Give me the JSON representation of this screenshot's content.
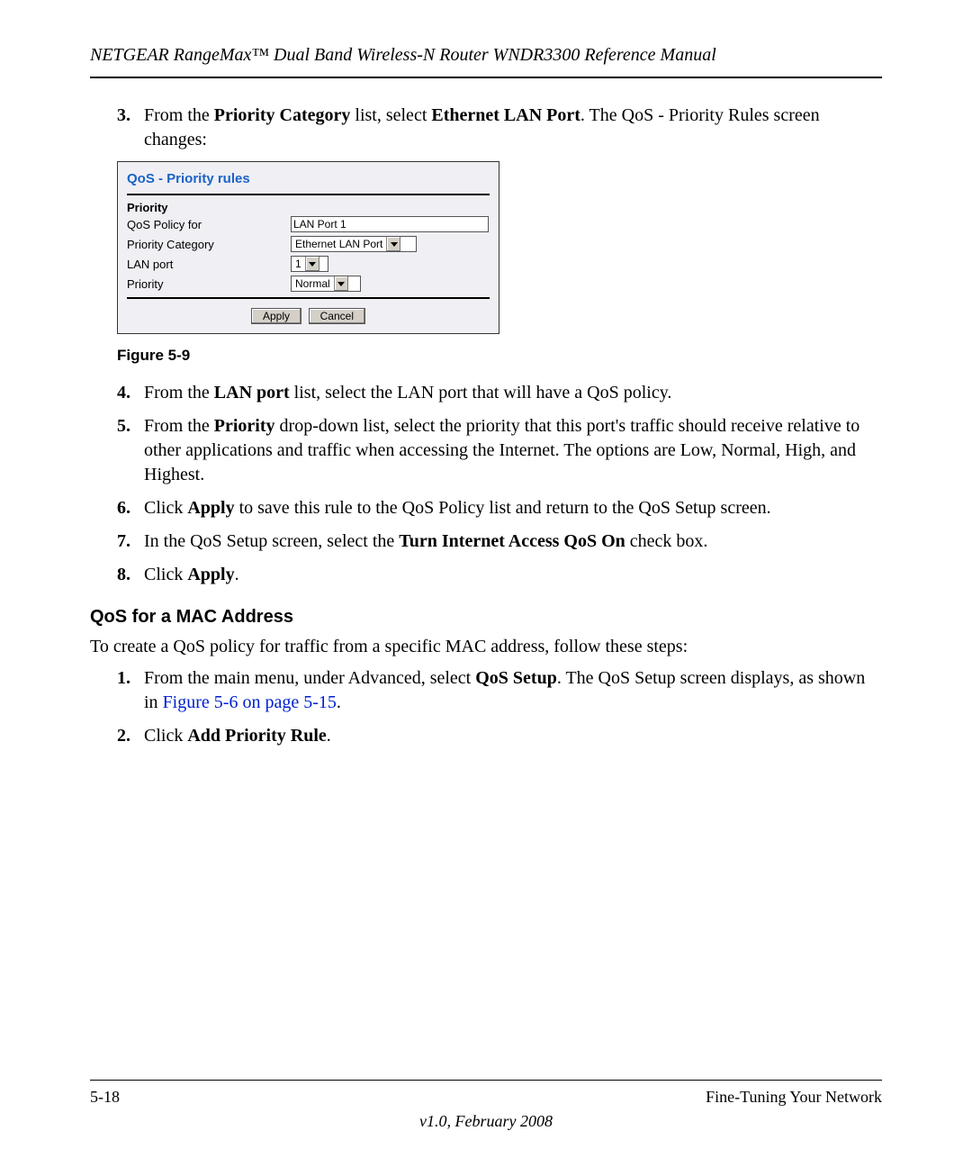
{
  "header": {
    "title": "NETGEAR RangeMax™ Dual Band Wireless-N Router WNDR3300 Reference Manual"
  },
  "steps_upper": [
    {
      "num": "3.",
      "html": "From the <b>Priority Category</b> list, select <b>Ethernet LAN Port</b>. The QoS - Priority Rules screen changes:"
    }
  ],
  "qos": {
    "panel_title": "QoS - Priority rules",
    "section_label": "Priority",
    "rows": {
      "policy_label": "QoS Policy for",
      "policy_value": "LAN Port 1",
      "category_label": "Priority Category",
      "category_value": "Ethernet LAN Port",
      "lanport_label": "LAN port",
      "lanport_value": "1",
      "priority_label": "Priority",
      "priority_value": "Normal"
    },
    "buttons": {
      "apply": "Apply",
      "cancel": "Cancel"
    }
  },
  "figure_caption": "Figure 5-9",
  "steps_mid": [
    {
      "num": "4.",
      "html": "From the <b>LAN port</b> list, select the LAN port that will have a QoS policy."
    },
    {
      "num": "5.",
      "html": "From the <b>Priority</b> drop-down list, select the priority that this port's traffic should receive relative to other applications and traffic when accessing the Internet. The options are Low, Normal, High, and Highest."
    },
    {
      "num": "6.",
      "html": "Click <b>Apply</b> to save this rule to the QoS Policy list and return to the QoS Setup screen."
    },
    {
      "num": "7.",
      "html": "In the QoS Setup screen, select the <b>Turn Internet Access QoS On</b> check box."
    },
    {
      "num": "8.",
      "html": "Click <b>Apply</b>."
    }
  ],
  "subheading": "QoS for a MAC Address",
  "subhead_intro": "To create a QoS policy for traffic from a specific MAC address, follow these steps:",
  "steps_lower": [
    {
      "num": "1.",
      "html": "From the main menu, under Advanced, select <b>QoS Setup</b>. The QoS Setup screen displays, as shown in <span class=\"xref\">Figure 5-6 on page 5-15</span>."
    },
    {
      "num": "2.",
      "html": "Click <b>Add Priority Rule</b>."
    }
  ],
  "footer": {
    "page_num": "5-18",
    "section": "Fine-Tuning Your Network",
    "version": "v1.0, February 2008"
  }
}
